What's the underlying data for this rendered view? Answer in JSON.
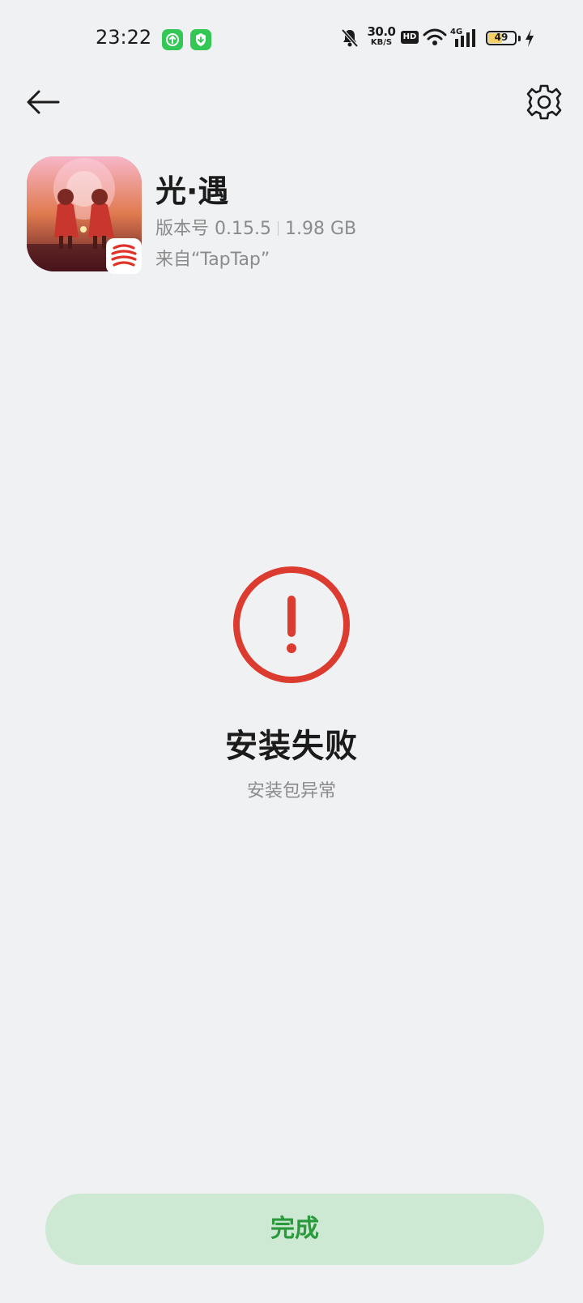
{
  "status_bar": {
    "time": "23:22",
    "speed_value": "30.0",
    "speed_unit": "KB/S",
    "hd": "HD",
    "network": "4G",
    "battery": "49"
  },
  "app": {
    "name": "光·遇",
    "version": "版本号 0.15.5",
    "size": "1.98 GB",
    "source": "来自“TapTap”"
  },
  "result": {
    "title": "安装失败",
    "subtitle": "安装包异常"
  },
  "actions": {
    "done_label": "完成"
  },
  "colors": {
    "background": "#f0f1f3",
    "error": "#dc3b2f",
    "button_bg": "#cde9d3",
    "button_text": "#2b9a3c"
  }
}
